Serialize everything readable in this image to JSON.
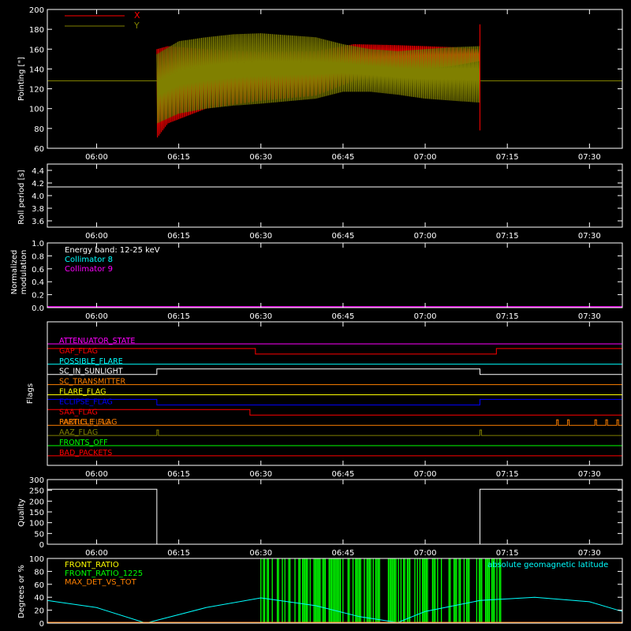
{
  "colors": {
    "background": "#000000",
    "axes": "#ffffff",
    "x_red": "#ff0000",
    "y_olive": "#808000",
    "cyan": "#00ffff",
    "magenta": "#ff00ff",
    "white": "#ffffff",
    "green": "#00ff00",
    "orange": "#ff8000",
    "yellow": "#ffff00",
    "blue": "#0000ff"
  },
  "time_ticks": [
    "06:00",
    "06:15",
    "06:30",
    "06:45",
    "07:00",
    "07:15",
    "07:30"
  ],
  "chart_data": [
    {
      "type": "line",
      "id": "pointing",
      "ylabel": "Pointing [\"]",
      "xlim": [
        "05:51",
        "07:36"
      ],
      "ylim": [
        60,
        200
      ],
      "yticks": [
        60,
        80,
        100,
        120,
        140,
        160,
        180,
        200
      ],
      "legend": [
        "X",
        "Y"
      ],
      "legend_position": "top-left",
      "series": [
        {
          "name": "X",
          "color": "#ff0000",
          "description": "oscillating envelope",
          "x": [
            "06:11",
            "06:13",
            "06:20",
            "06:30",
            "06:40",
            "06:47",
            "06:55",
            "07:00",
            "07:05",
            "07:10"
          ],
          "upper": [
            160,
            163,
            160,
            157,
            158,
            165,
            164,
            163,
            162,
            160
          ],
          "lower": [
            70,
            85,
            100,
            108,
            113,
            128,
            135,
            140,
            143,
            148
          ]
        },
        {
          "name": "Y",
          "color": "#808000",
          "description": "oscillating envelope with flat baseline outside data interval",
          "baseline": 128,
          "x": [
            "06:11",
            "06:15",
            "06:20",
            "06:25",
            "06:30",
            "06:40",
            "06:45",
            "06:50",
            "06:55",
            "07:00",
            "07:05",
            "07:10"
          ],
          "upper": [
            155,
            168,
            172,
            175,
            176,
            172,
            165,
            160,
            158,
            160,
            162,
            163
          ],
          "lower": [
            85,
            95,
            100,
            103,
            105,
            110,
            117,
            117,
            114,
            110,
            108,
            106
          ]
        }
      ]
    },
    {
      "type": "line",
      "id": "roll-period",
      "ylabel": "Roll period [s]",
      "ylim": [
        3.5,
        4.5
      ],
      "yticks": [
        "3.6",
        "3.8",
        "4.0",
        "4.2",
        "4.4"
      ],
      "series": [
        {
          "color": "#ffffff",
          "x": [
            "05:51",
            "07:36"
          ],
          "y": [
            4.15,
            4.15
          ]
        }
      ]
    },
    {
      "type": "line",
      "id": "modulation",
      "ylabel_lines": [
        "Normalized",
        "modulation"
      ],
      "ylim": [
        0,
        1
      ],
      "yticks": [
        "0.0",
        "0.2",
        "0.4",
        "0.6",
        "0.8",
        "1.0"
      ],
      "annotations": [
        {
          "text": "Energy band: 12-25 keV",
          "color": "#ffffff"
        },
        {
          "text": "Collimator 8",
          "color": "#00ffff"
        },
        {
          "text": "Collimator 9",
          "color": "#ff00ff"
        }
      ],
      "series": [
        {
          "color": "#ff00ff",
          "x": [
            "05:51",
            "07:36"
          ],
          "y": [
            0,
            0
          ]
        }
      ]
    },
    {
      "type": "step",
      "id": "flags",
      "ylabel": "Flags",
      "flags": [
        {
          "label": "ATTENUATOR_STATE",
          "color": "#ff00ff",
          "steps": []
        },
        {
          "label": "GAP_FLAG",
          "color": "#ff0000",
          "steps": [
            [
              "05:51",
              1
            ],
            [
              "06:29",
              0
            ],
            [
              "07:13",
              1
            ]
          ]
        },
        {
          "label": "POSSIBLE_FLARE",
          "color": "#00ffff",
          "steps": []
        },
        {
          "label": "SC_IN_SUNLIGHT",
          "color": "#ffffff",
          "steps": [
            [
              "05:51",
              0
            ],
            [
              "06:11",
              1
            ],
            [
              "07:10",
              0
            ]
          ]
        },
        {
          "label": "SC_TRANSMITTER",
          "color": "#ff8000",
          "steps": []
        },
        {
          "label": "FLARE_FLAG",
          "color": "#ffff00",
          "steps": []
        },
        {
          "label": "ECLIPSE_FLAG",
          "color": "#0000ff",
          "steps": [
            [
              "05:51",
              1
            ],
            [
              "06:11",
              0
            ],
            [
              "07:10",
              1
            ]
          ]
        },
        {
          "label": "SAA_FLAG",
          "color": "#ff0000",
          "steps": [
            [
              "05:51",
              1
            ],
            [
              "06:28",
              0
            ]
          ]
        },
        {
          "label": "PARTICLE_FLAG",
          "color": "#ff8000",
          "overlap_label": "RADIUS_FLAG",
          "spikes": [
            "07:24",
            "07:26",
            "07:31",
            "07:33",
            "07:35"
          ]
        },
        {
          "label": "AAZ_FLAG",
          "color": "#808000",
          "spikes": [
            "06:11",
            "07:10"
          ]
        },
        {
          "label": "FRONTS_OFF",
          "color": "#00ff00",
          "steps": []
        },
        {
          "label": "BAD_PACKETS",
          "color": "#ff0000",
          "steps": []
        }
      ]
    },
    {
      "type": "step",
      "id": "quality",
      "ylabel": "Quality",
      "ylim": [
        0,
        300
      ],
      "yticks": [
        0,
        50,
        100,
        150,
        200,
        250,
        300
      ],
      "series": [
        {
          "color": "#ffffff",
          "steps": [
            [
              "05:51",
              255
            ],
            [
              "06:11",
              0
            ],
            [
              "07:10",
              255
            ]
          ]
        }
      ]
    },
    {
      "type": "line",
      "id": "degrees",
      "ylabel": "Degrees or %",
      "ylim": [
        0,
        100
      ],
      "yticks": [
        0,
        20,
        40,
        60,
        80,
        100
      ],
      "legend": [
        {
          "text": "FRONT_RATIO",
          "color": "#ffff00"
        },
        {
          "text": "FRONT_RATIO_1225",
          "color": "#00ff00"
        },
        {
          "text": "MAX_DET_VS_TOT",
          "color": "#ff8000"
        }
      ],
      "right_label": {
        "text": "absolute geomagnetic latitude",
        "color": "#00ffff"
      },
      "series": [
        {
          "name": "absolute geomagnetic latitude",
          "color": "#00ffff",
          "x": [
            "05:51",
            "06:00",
            "06:09",
            "06:20",
            "06:30",
            "06:40",
            "06:48",
            "06:55",
            "07:00",
            "07:10",
            "07:20",
            "07:30",
            "07:36"
          ],
          "y": [
            35,
            24,
            0,
            24,
            39,
            27,
            10,
            1,
            18,
            35,
            40,
            33,
            18
          ]
        },
        {
          "name": "FRONT_RATIO_1225",
          "color": "#00ff00",
          "description": "dense bars between 06:30 and 07:15"
        }
      ]
    }
  ]
}
